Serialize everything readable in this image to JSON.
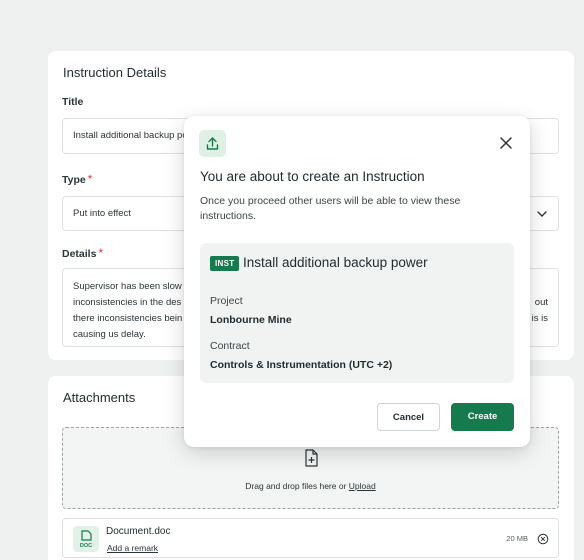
{
  "details": {
    "title": "Instruction Details",
    "title_label": "Title",
    "title_value": "Install additional backup power",
    "type_label": "Type",
    "type_value": "Put into effect",
    "details_label": "Details",
    "details_line1_left": "Supervisor has been slow",
    "details_line2_left": "inconsistencies in the des",
    "details_line3_left": "there inconsistencies bein",
    "details_line4": "causing us delay.",
    "details_line2_right": "out",
    "details_line3_right": "is is",
    "required_mark": "*"
  },
  "attachments": {
    "title": "Attachments",
    "drop_text": "Drag and drop files here or ",
    "upload_label": "Upload",
    "file_name": "Document.doc",
    "file_ext": "DOC",
    "remark_label": "Add a remark",
    "file_size": "20 MB"
  },
  "modal": {
    "title": "You are about to create an Instruction",
    "description": "Once you proceed other users will be able to view these instructions.",
    "tag": "INST",
    "instruction_title": "Install additional backup power",
    "project_label": "Project",
    "project_value": "Lonbourne Mine",
    "contract_label": "Contract",
    "contract_value": "Controls & Instrumentation (UTC +2)",
    "cancel_label": "Cancel",
    "create_label": "Create"
  },
  "colors": {
    "brand": "#167a4f",
    "required": "#d8383a",
    "background": "#eef1f0"
  },
  "icons": [
    "upload-icon",
    "close-icon",
    "chevron-down-icon",
    "file-add-icon",
    "doc-file-icon",
    "remove-icon"
  ]
}
